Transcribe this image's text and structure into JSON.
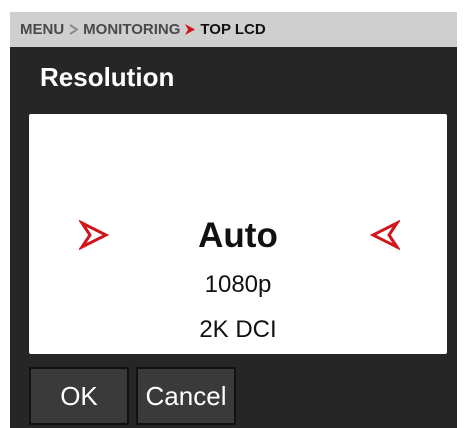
{
  "breadcrumb": {
    "items": [
      "MENU",
      "MONITORING",
      "TOP LCD"
    ]
  },
  "title": "Resolution",
  "picker": {
    "options": [
      "Auto",
      "1080p",
      "2K DCI"
    ],
    "selected_index": 0
  },
  "buttons": {
    "ok": "OK",
    "cancel": "Cancel"
  },
  "colors": {
    "background": "#262626",
    "breadcrumb_bg": "#cfcfcf",
    "accent_red": "#d0151b",
    "picker_bg": "#ffffff",
    "button_bg": "#3a3a3a"
  },
  "icons": {
    "breadcrumb_separator": "chevron-right-icon",
    "picker_prev": "red-arrow-right-icon",
    "picker_next": "red-arrow-left-icon"
  }
}
